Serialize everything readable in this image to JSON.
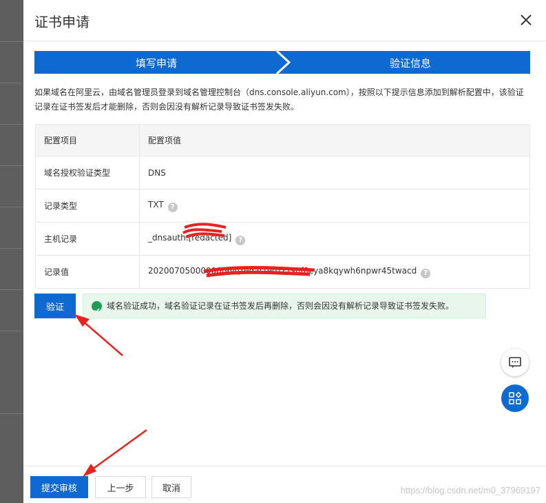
{
  "dialog": {
    "title": "证书申请",
    "close_icon": "close-icon"
  },
  "steps": [
    {
      "label": "填写申请"
    },
    {
      "label": "验证信息"
    }
  ],
  "notice": "如果域名在阿里云，由域名管理员登录到域名管理控制台（dns.console.aliyun.com），按照以下提示信息添加到解析配置中，该验证记录在证书签发后才能删除，否则会因没有解析记录导致证书签发失败。",
  "config_table": {
    "headers": [
      "配置项目",
      "配置项值"
    ],
    "rows": [
      {
        "key": "域名授权验证类型",
        "value": "DNS",
        "help": false
      },
      {
        "key": "记录类型",
        "value": "TXT",
        "help": true
      },
      {
        "key": "主机记录",
        "value": "_dnsauth.[redacted]",
        "help": true
      },
      {
        "key": "记录值",
        "value": "20200705000000064[redacted]21snf8cya8kqywh6npwr45twacd",
        "help": true
      }
    ]
  },
  "verify_button": "验证",
  "success_message": "域名验证成功，域名验证记录在证书签发后再删除，否则会因没有解析记录导致证书签发失败。",
  "footer": {
    "submit_label": "提交审核",
    "prev_label": "上一步",
    "cancel_label": "取消"
  },
  "watermark": "https://blog.csdn.net/m0_37969197",
  "colors": {
    "primary": "#0e6ad1",
    "success": "#1e9e54",
    "annotation_red": "#e8231f"
  }
}
